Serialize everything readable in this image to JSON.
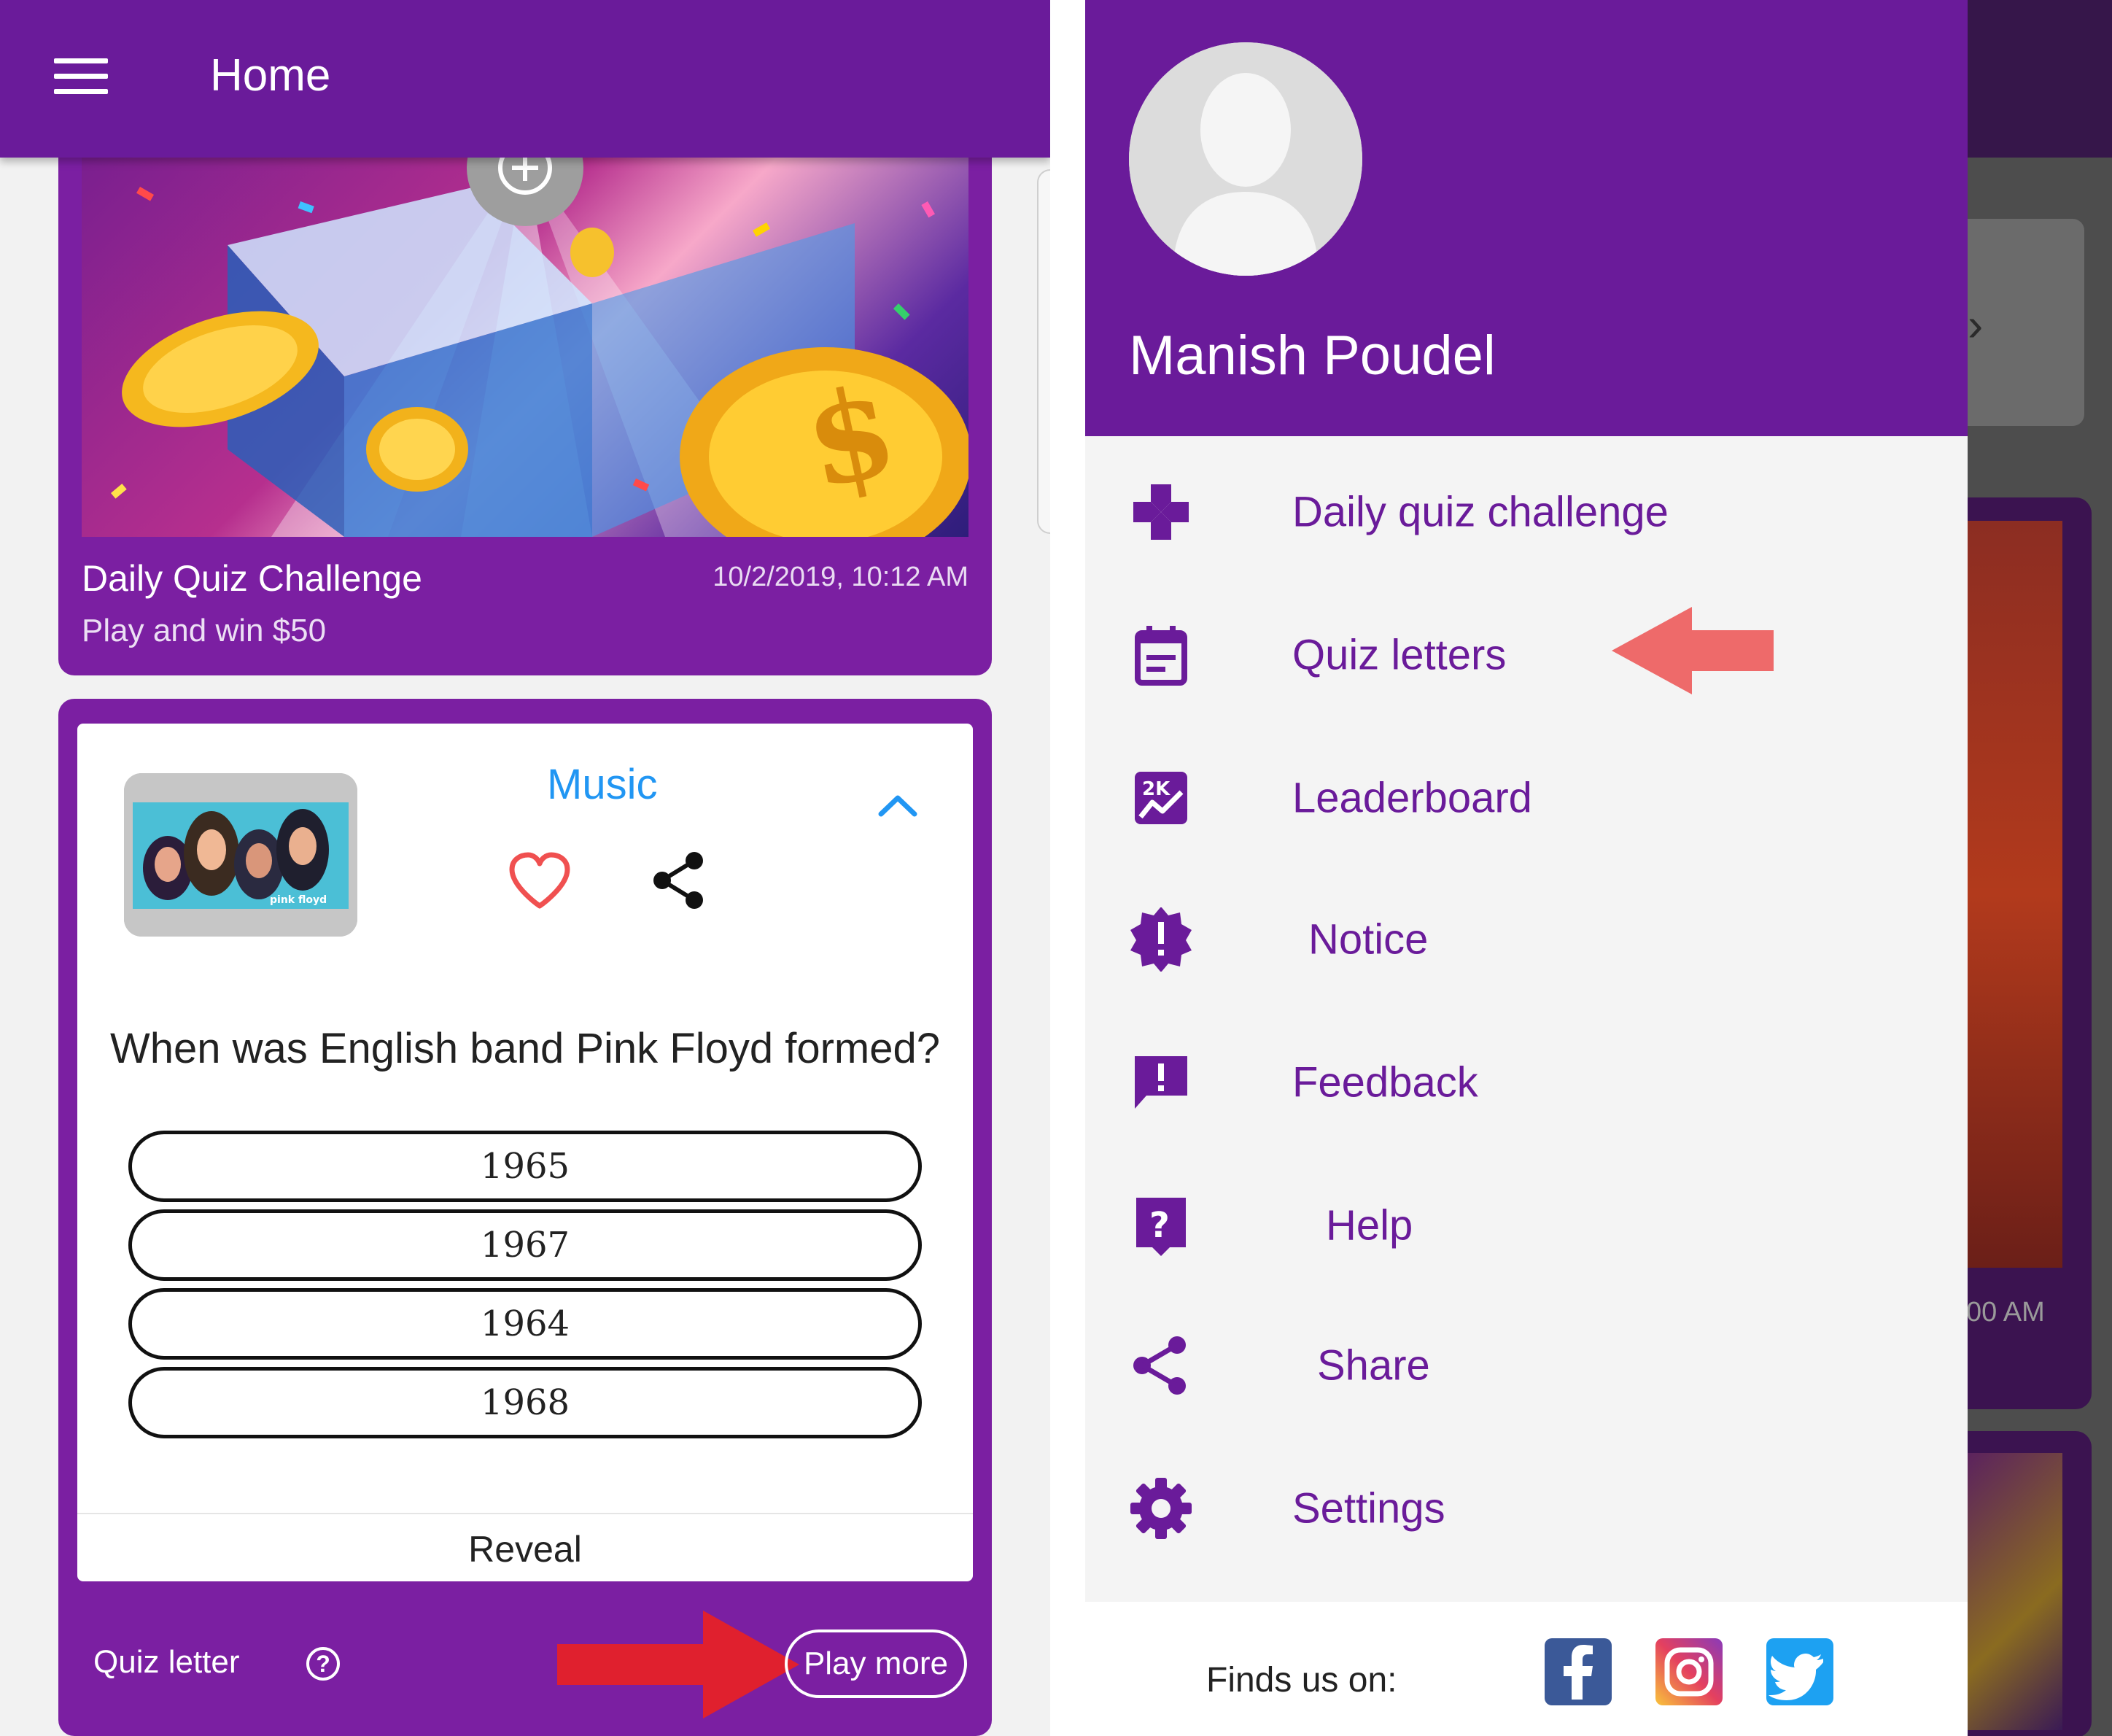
{
  "left_screen": {
    "appbar": {
      "title": "Home"
    },
    "challenge_card": {
      "title": "Daily Quiz Challenge",
      "timestamp": "10/2/2019, 10:12 AM",
      "subtitle": "Play and win $50"
    },
    "quiz_card": {
      "category": "Music",
      "question": "When was English band Pink Floyd formed?",
      "options": [
        "1965",
        "1967",
        "1964",
        "1968"
      ],
      "reveal_label": "Reveal",
      "quiz_letter_label": "Quiz letter",
      "help_glyph": "?",
      "play_more_label": "Play more",
      "thumbnail_caption": "pink floyd"
    }
  },
  "right_screen": {
    "drawer": {
      "user_name": "Manish Poudel",
      "menu": [
        {
          "label": "Daily quiz challenge",
          "icon": "gamepad-icon"
        },
        {
          "label": "Quiz letters",
          "icon": "calendar-note-icon"
        },
        {
          "label": "Leaderboard",
          "icon": "leaderboard-icon"
        },
        {
          "label": "Notice",
          "icon": "alert-badge-icon"
        },
        {
          "label": "Feedback",
          "icon": "feedback-icon"
        },
        {
          "label": "Help",
          "icon": "help-icon"
        },
        {
          "label": "Share",
          "icon": "share-icon"
        },
        {
          "label": "Settings",
          "icon": "gear-icon"
        }
      ],
      "footer": {
        "finds_us_label": "Finds us on:",
        "socials": [
          "facebook-icon",
          "instagram-icon",
          "twitter-icon"
        ]
      }
    },
    "background_timestamp_fragment": "00 AM",
    "leaderboard_icon_text": "2K"
  },
  "colors": {
    "primary_purple": "#6a1b9a",
    "card_purple": "#7b1fa2",
    "category_blue": "#2196f3",
    "heart_red": "#f05050",
    "annotation_red": "#e0202e",
    "annotation_pink": "#ee6a6a"
  }
}
